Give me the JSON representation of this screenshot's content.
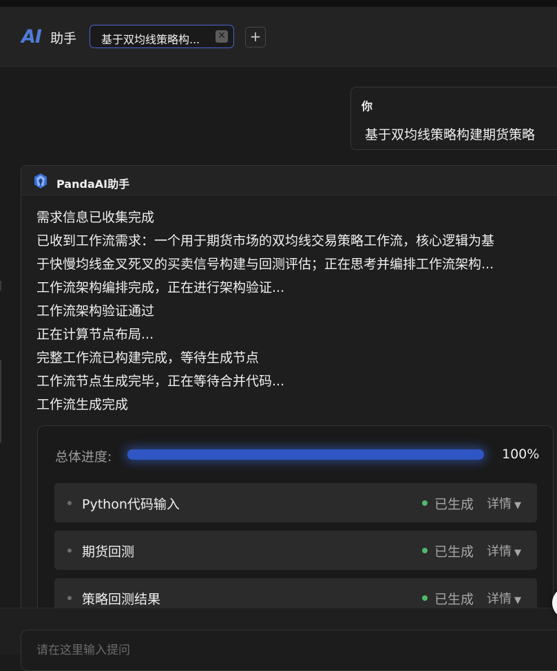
{
  "header": {
    "logo": "AI",
    "app_title": "助手",
    "tab_label": "基于双均线策略构...",
    "tab_close": "✕",
    "tab_add": "+"
  },
  "user_message": {
    "sender": "你",
    "text": "基于双均线策略构建期货策略"
  },
  "assistant_message": {
    "sender": "PandaAI助手",
    "lines": [
      "需求信息已收集完成",
      "已收到工作流需求：一个用于期货市场的双均线交易策略工作流，核心逻辑为基",
      "于快慢均线金叉死叉的买卖信号构建与回测评估；正在思考并编排工作流架构...",
      "工作流架构编排完成，正在进行架构验证...",
      "工作流架构验证通过",
      "正在计算节点布局...",
      "完整工作流已构建完成，等待生成节点",
      "工作流节点生成完毕，正在等待合并代码...",
      "工作流生成完成"
    ]
  },
  "progress": {
    "label": "总体进度:",
    "value_text": "100%",
    "fraction": 1.0
  },
  "nodes": [
    {
      "name": "Python代码输入",
      "status": "已生成",
      "detail": "详情",
      "arrow": "▼"
    },
    {
      "name": "期货回测",
      "status": "已生成",
      "detail": "详情",
      "arrow": "▼"
    },
    {
      "name": "策略回测结果",
      "status": "已生成",
      "detail": "详情",
      "arrow": "▼"
    }
  ],
  "input": {
    "placeholder": "请在这里输入提问",
    "value": ""
  },
  "colors": {
    "accent": "#4a67d6",
    "progress_fill": "#2f56c4",
    "status_ok": "#52b86a"
  }
}
